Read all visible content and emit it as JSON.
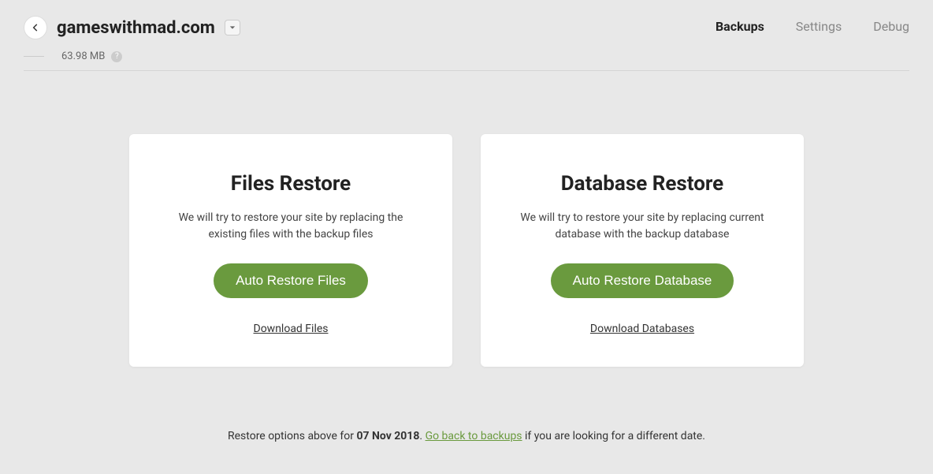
{
  "header": {
    "site_title": "gameswithmad.com",
    "tabs": {
      "backups": "Backups",
      "settings": "Settings",
      "debug": "Debug"
    }
  },
  "sub_header": {
    "size": "63.98 MB",
    "help_glyph": "?"
  },
  "cards": {
    "files": {
      "title": "Files Restore",
      "desc": "We will try to restore your site by replacing the existing files with the backup files",
      "button": "Auto Restore Files",
      "link": "Download Files"
    },
    "database": {
      "title": "Database Restore",
      "desc": "We will try to restore your site by replacing current database with the backup database",
      "button": "Auto Restore Database",
      "link": "Download Databases"
    }
  },
  "footer": {
    "pre": "Restore options above for ",
    "date": "07 Nov 2018",
    "sep": ". ",
    "link": "Go back to backups",
    "post": " if you are looking for a different date."
  }
}
